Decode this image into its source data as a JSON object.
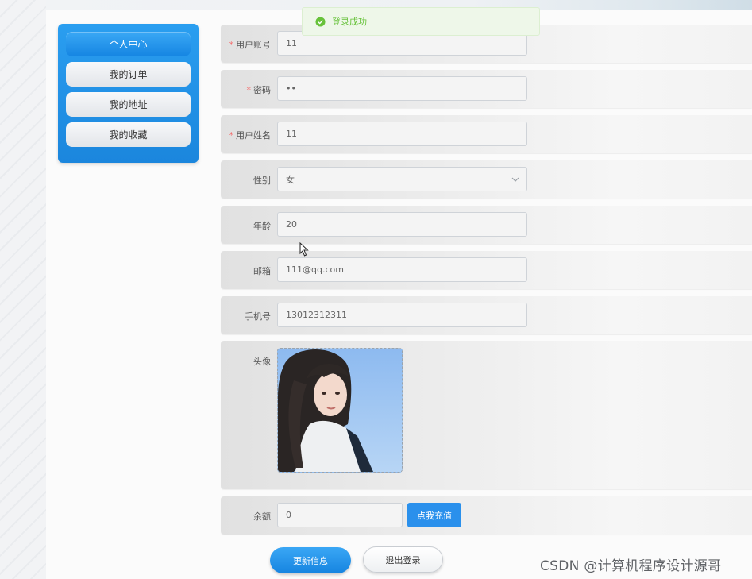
{
  "toast": {
    "message": "登录成功",
    "icon": "check-circle-icon",
    "color": "#67c23a"
  },
  "sidebar": {
    "items": [
      {
        "label": "个人中心",
        "active": true
      },
      {
        "label": "我的订单",
        "active": false
      },
      {
        "label": "我的地址",
        "active": false
      },
      {
        "label": "我的收藏",
        "active": false
      }
    ]
  },
  "form": {
    "username": {
      "label": "用户账号",
      "required": true,
      "value": "11"
    },
    "password": {
      "label": "密码",
      "required": true,
      "value": "••"
    },
    "realname": {
      "label": "用户姓名",
      "required": true,
      "value": "11"
    },
    "gender": {
      "label": "性别",
      "value": "女"
    },
    "age": {
      "label": "年龄",
      "value": "20"
    },
    "email": {
      "label": "邮箱",
      "value": "111@qq.com"
    },
    "phone": {
      "label": "手机号",
      "value": "13012312311"
    },
    "avatar": {
      "label": "头像"
    },
    "balance": {
      "label": "余额",
      "value": "0",
      "recharge_label": "点我充值"
    }
  },
  "actions": {
    "update_label": "更新信息",
    "logout_label": "退出登录"
  },
  "watermark": "CSDN @计算机程序设计源哥",
  "colors": {
    "primary": "#1b86dd",
    "required": "#f56c6c",
    "success": "#67c23a"
  }
}
